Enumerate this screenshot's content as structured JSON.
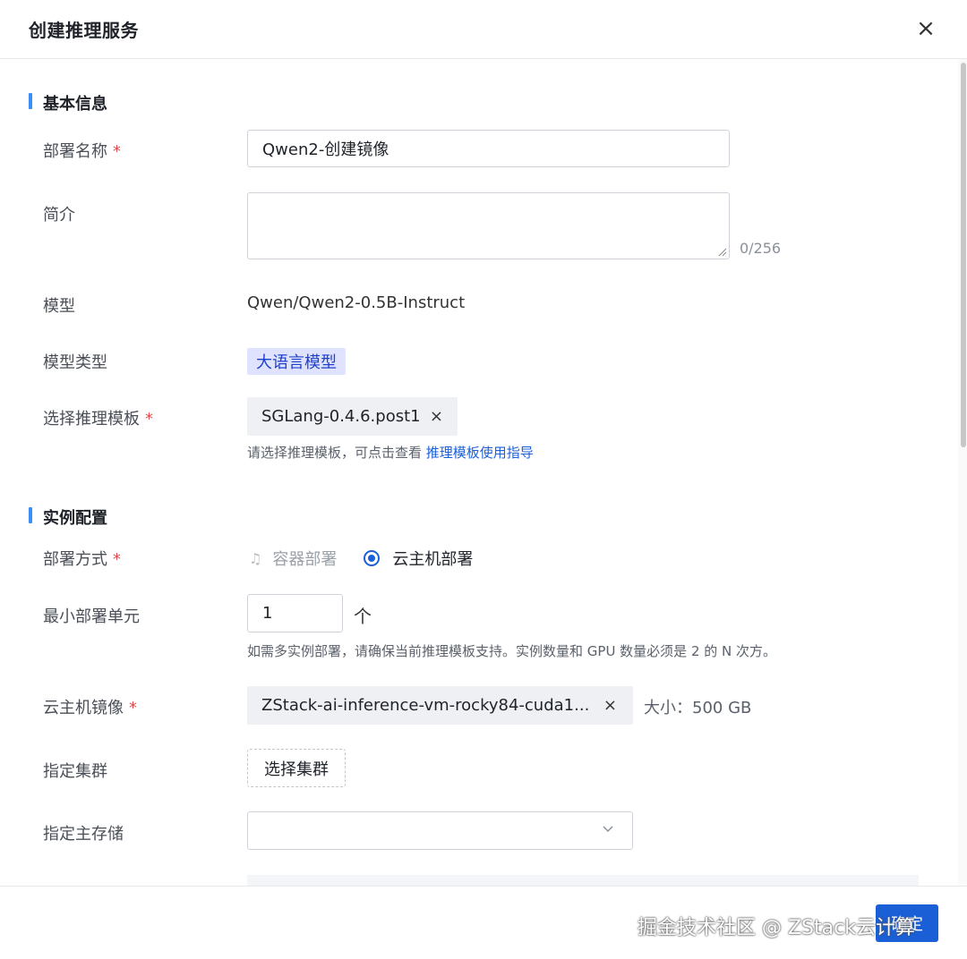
{
  "dialog": {
    "title": "创建推理服务",
    "close_glyph": "×"
  },
  "basic_section": {
    "title": "基本信息",
    "name_label": "部署名称",
    "required_mark": "*",
    "name_value": "Qwen2-创建镜像",
    "intro_label": "简介",
    "intro_counter": "0/256",
    "model_label": "模型",
    "model_value": "Qwen/Qwen2-0.5B-Instruct",
    "model_type_label": "模型类型",
    "model_type_tag": "大语言模型",
    "template_label": "选择推理模板",
    "template_value": "SGLang-0.4.6.post1",
    "remove_glyph": "×",
    "template_hint": "请选择推理模板，可点击查看",
    "template_hint_link": "推理模板使用指导"
  },
  "instance_section": {
    "title": "实例配置",
    "deploy_label": "部署方式",
    "deploy_option_container": "容器部署",
    "deploy_option_vm": "云主机部署",
    "deploy_selected": "云主机部署",
    "min_unit_label": "最小部署单元",
    "min_unit_value": "1",
    "min_unit_suffix": "个",
    "min_unit_hint": "如需多实例部署，请确保当前推理模板支持。实例数量和 GPU 数量必须是 2 的 N 次方。",
    "vm_image_label": "云主机镜像",
    "vm_image_value": "ZStack-ai-inference-vm-rocky84-cuda1...",
    "vm_image_size": "大小：500 GB",
    "cluster_label": "指定集群",
    "cluster_button": "选择集群",
    "storage_label": "指定主存储",
    "storage_value": ""
  },
  "footer": {
    "watermark": "掘金技术社区 @ ZStack云计算",
    "confirm_label": "确定"
  },
  "icons": {
    "close": "close-icon",
    "remove": "remove-icon",
    "chevron": "chevron-down-icon",
    "container": "container-icon",
    "radio": "radio-selected-icon"
  },
  "colors": {
    "accent": "#1a5fd6",
    "section_bar": "#3a8ef6",
    "required": "#e5484d",
    "tag_blue_bg": "#dfe3ff"
  }
}
